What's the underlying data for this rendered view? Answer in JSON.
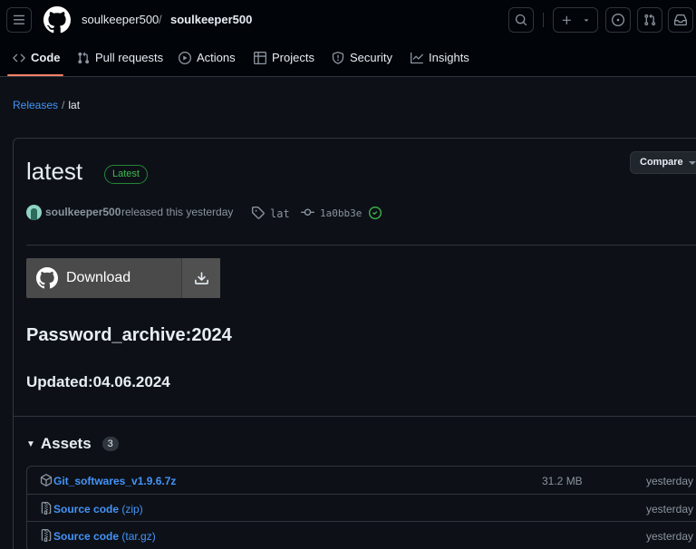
{
  "header": {
    "owner": "soulkeeper500",
    "separator": "/",
    "repo": "soulkeeper500",
    "icons": [
      "hamburger-icon",
      "github-logo-icon",
      "search-icon",
      "plus-icon",
      "chevron-down-icon",
      "issues-icon",
      "pull-request-icon",
      "inbox-icon"
    ]
  },
  "tabs": [
    {
      "label": "Code",
      "icon": "code-icon",
      "active": true
    },
    {
      "label": "Pull requests",
      "icon": "pull-request-icon"
    },
    {
      "label": "Actions",
      "icon": "play-icon"
    },
    {
      "label": "Projects",
      "icon": "table-icon"
    },
    {
      "label": "Security",
      "icon": "shield-icon"
    },
    {
      "label": "Insights",
      "icon": "graph-icon"
    }
  ],
  "breadcrumb": {
    "link": "Releases",
    "sep": "/",
    "current": "lat"
  },
  "release": {
    "title": "latest",
    "badge": "Latest",
    "compare": "Compare",
    "author": "soulkeeper500",
    "released": "released this yesterday",
    "tag": "lat",
    "commit": "1a0bb3e",
    "download_label": "Download",
    "heading1": "Password_archive:2024",
    "heading2": "Updated:04.06.2024"
  },
  "assets": {
    "title": "Assets",
    "count": "3",
    "items": [
      {
        "name": "Git_softwares_v1.9.6.7z",
        "sub": "",
        "size": "31.2 MB",
        "date": "yesterday",
        "icon": "package-icon"
      },
      {
        "name": "Source code",
        "sub": " (zip)",
        "size": "",
        "date": "yesterday",
        "icon": "file-zip-icon"
      },
      {
        "name": "Source code",
        "sub": " (tar.gz)",
        "size": "",
        "date": "yesterday",
        "icon": "file-zip-icon"
      }
    ]
  },
  "colors": {
    "background": "#0d1117",
    "link": "#4493f8",
    "latest_badge": "#3fb950",
    "tab_underline": "#f78166"
  }
}
